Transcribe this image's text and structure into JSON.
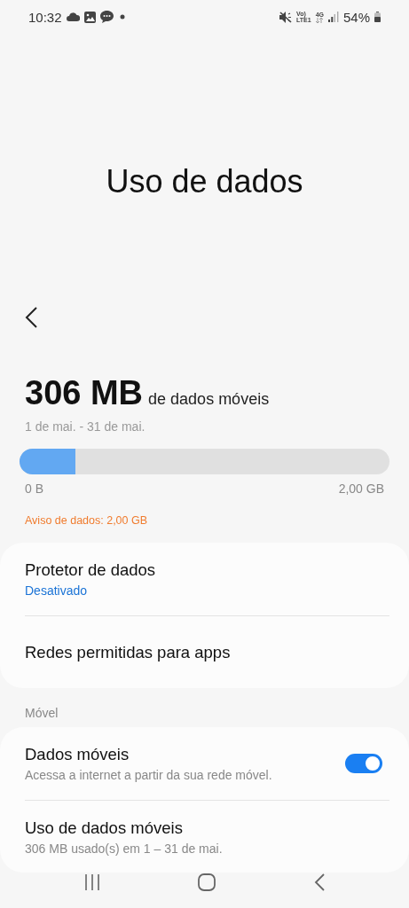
{
  "status_bar": {
    "time": "10:32",
    "network_labels": [
      "Vo)",
      "LTE1",
      "4G"
    ],
    "battery": "54%"
  },
  "title": "Uso de dados",
  "usage": {
    "amount": "306 MB",
    "unit_label": "de dados móveis",
    "period": "1 de mai. - 31 de mai.",
    "level": 0.15,
    "min_label": "0 B",
    "max_label": "2,00 GB",
    "warning": "Aviso de dados: 2,00 GB"
  },
  "sections": [
    {
      "rows": [
        {
          "kind": "link",
          "title": "Protetor de dados",
          "subtitle": "Desativado",
          "subtitle_accent": true
        },
        {
          "kind": "link",
          "title": "Redes permitidas para apps"
        }
      ]
    },
    {
      "header": "Móvel",
      "rows": [
        {
          "kind": "switch",
          "title": "Dados móveis",
          "subtitle": "Acessa a internet a partir da sua rede móvel.",
          "subtitle_accent": false,
          "on": true
        },
        {
          "kind": "link",
          "title": "Uso de dados móveis",
          "subtitle": "306 MB usado(s) em 1 – 31 de mai.",
          "subtitle_accent": false
        }
      ]
    }
  ]
}
